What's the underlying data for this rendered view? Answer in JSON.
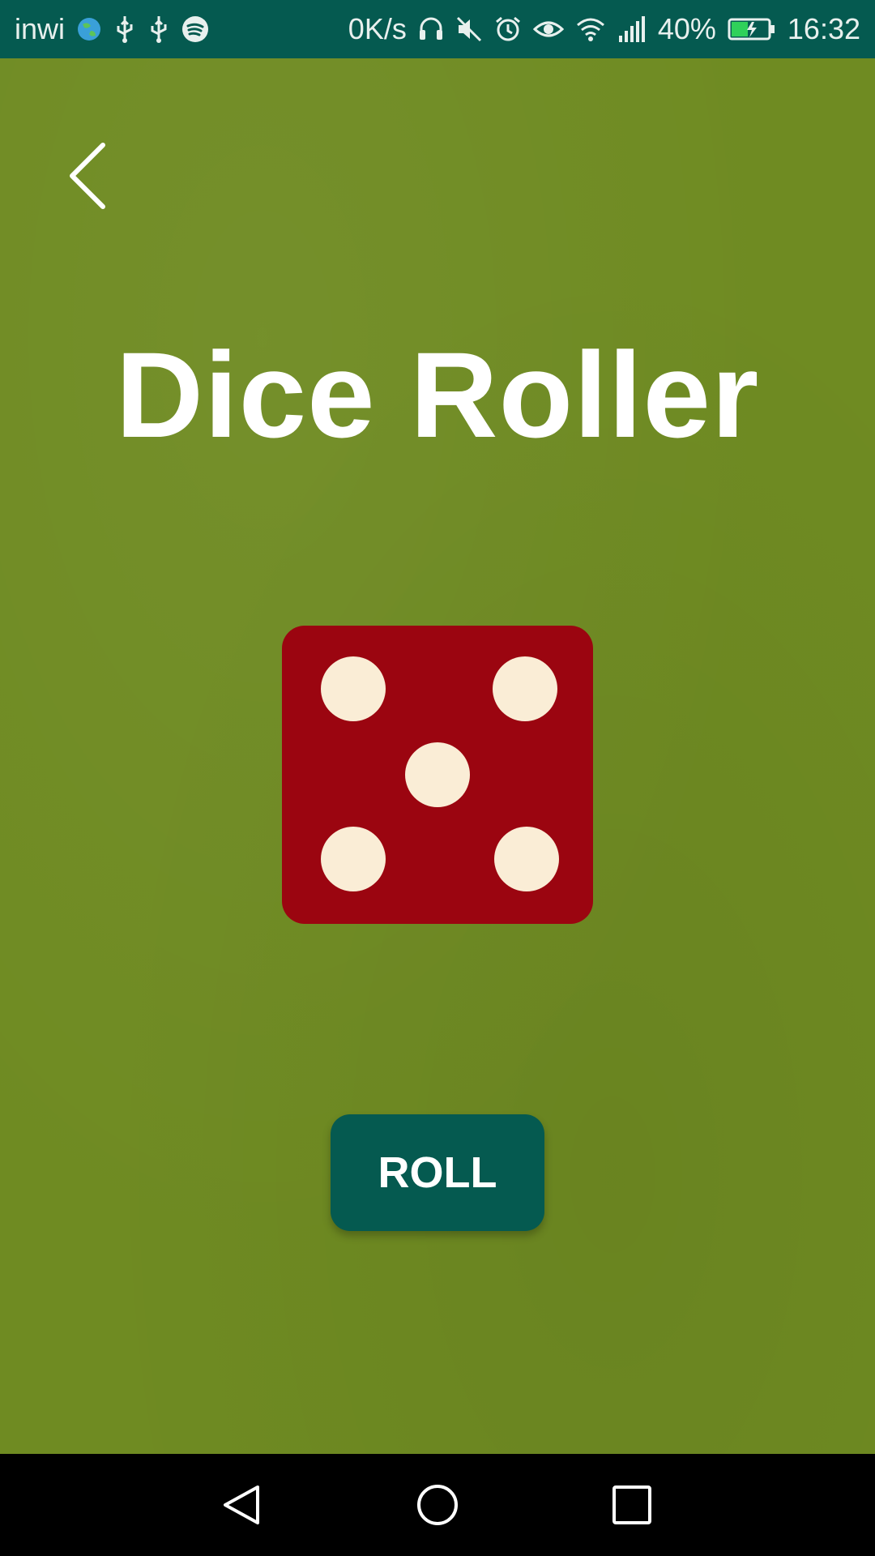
{
  "status_bar": {
    "carrier": "inwi",
    "net_speed": "0K/s",
    "battery_percent": "40%",
    "time": "16:32",
    "icons_left": [
      "globe-icon",
      "usb-icon",
      "usb-icon",
      "spotify-icon"
    ],
    "icons_right": [
      "headset-icon",
      "mute-icon",
      "alarm-icon",
      "eye-icon",
      "wifi-icon",
      "signal-icon",
      "battery-charging-icon"
    ]
  },
  "app": {
    "title": "Dice Roller",
    "die_value": 5,
    "roll_label": "ROLL"
  },
  "nav_bar": {
    "buttons": [
      "back-triangle-icon",
      "home-circle-icon",
      "recents-square-icon"
    ]
  },
  "colors": {
    "status_bar_bg": "#055a50",
    "background": "#6f8b22",
    "die_body": "#9b0510",
    "die_pip": "#faedd6",
    "button_bg": "#055a50",
    "text": "#ffffff"
  }
}
